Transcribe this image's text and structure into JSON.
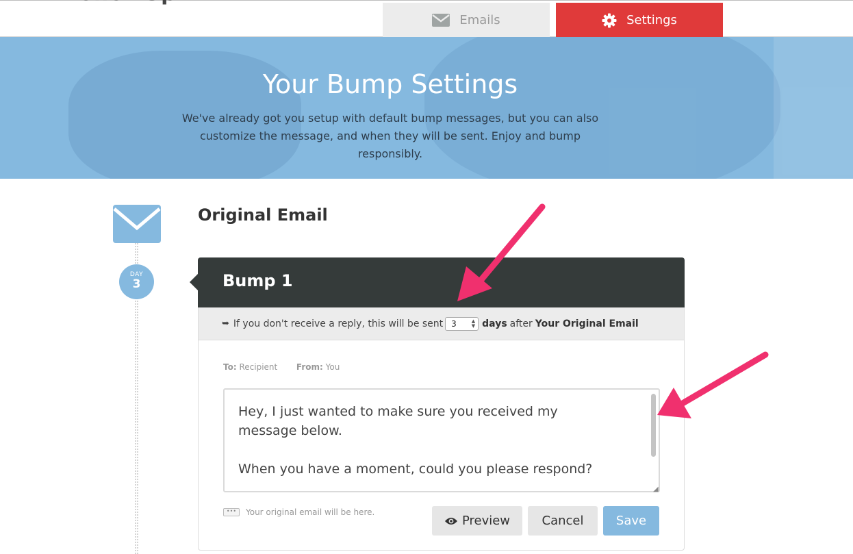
{
  "header": {
    "tabs": [
      {
        "label": "Emails",
        "icon": "envelope-icon",
        "active": false
      },
      {
        "label": "Settings",
        "icon": "gear-icon",
        "active": true
      }
    ],
    "accent_color": "#e03a3a"
  },
  "hero": {
    "title": "Your Bump Settings",
    "subtitle": "We've already got you setup with default bump messages, but you can also customize the message, and when they will be sent. Enjoy and bump responsibly.",
    "background_color": "#85b9df"
  },
  "timeline": {
    "envelope_icon": "envelope-icon",
    "day_label": "DAY",
    "day_number": "3"
  },
  "original": {
    "title": "Original Email"
  },
  "bump": {
    "title": "Bump 1",
    "send_prefix": "If you don't receive a reply, this will be sent",
    "days_value": "3",
    "days_label": "days",
    "after_text": "after",
    "after_target": "Your Original Email",
    "to_label": "To:",
    "to_value": "Recipient",
    "from_label": "From:",
    "from_value": "You",
    "message": "Hey, I just wanted to make sure you received my message below.\n\nWhen you have a moment, could you please respond?",
    "original_note": "Your original email will be here.",
    "buttons": {
      "preview": "Preview",
      "cancel": "Cancel",
      "save": "Save"
    }
  },
  "annotation_color": "#f0306e"
}
